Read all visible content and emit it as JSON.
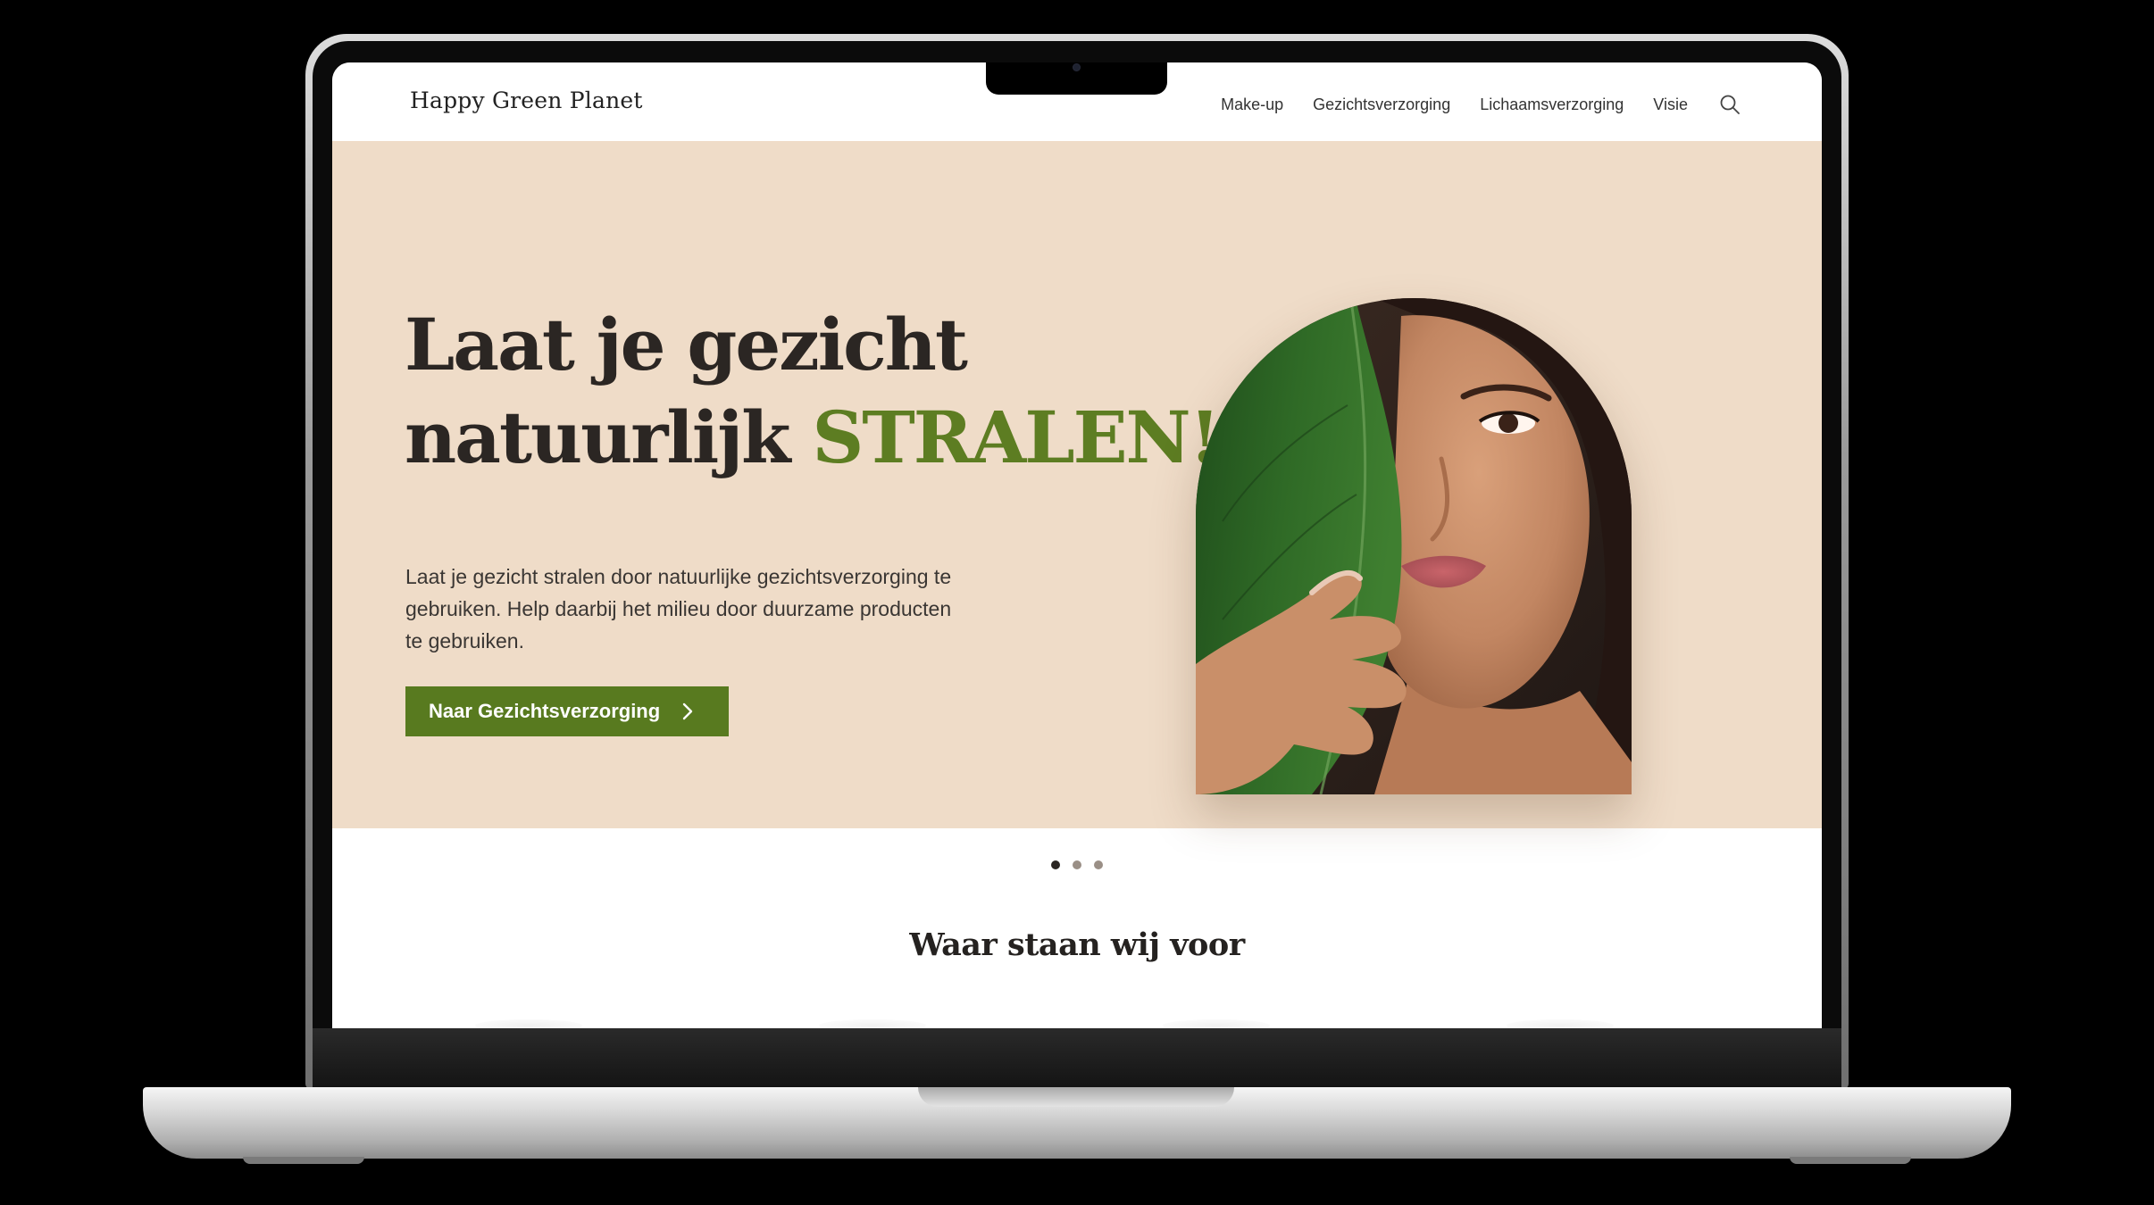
{
  "site": {
    "logo": "Happy Green Planet",
    "nav": {
      "items": [
        {
          "label": "Make-up"
        },
        {
          "label": "Gezichtsverzorging"
        },
        {
          "label": "Lichaamsverzorging"
        },
        {
          "label": "Visie"
        }
      ],
      "search_icon": "search-icon"
    },
    "hero": {
      "title_line1": "Laat je gezicht",
      "title_line2": "natuurlijk",
      "title_accent": "STRALEN!",
      "paragraph": "Laat je gezicht stralen door natuurlijke gezichtsverzorging te gebruiken. Help daarbij het milieu door duurzame producten te gebruiken.",
      "cta_label": "Naar Gezichtsverzorging",
      "cta_icon": "chevron-right-icon",
      "image": "portrait-with-green-leaf",
      "carousel": {
        "total": 3,
        "active": 1
      }
    },
    "section": {
      "title": "Waar staan wij voor"
    },
    "colors": {
      "hero_bg": "#efdcc8",
      "accent_green": "#5d7d22",
      "button_green": "#587a1f",
      "text_dark": "#2b2623"
    }
  }
}
